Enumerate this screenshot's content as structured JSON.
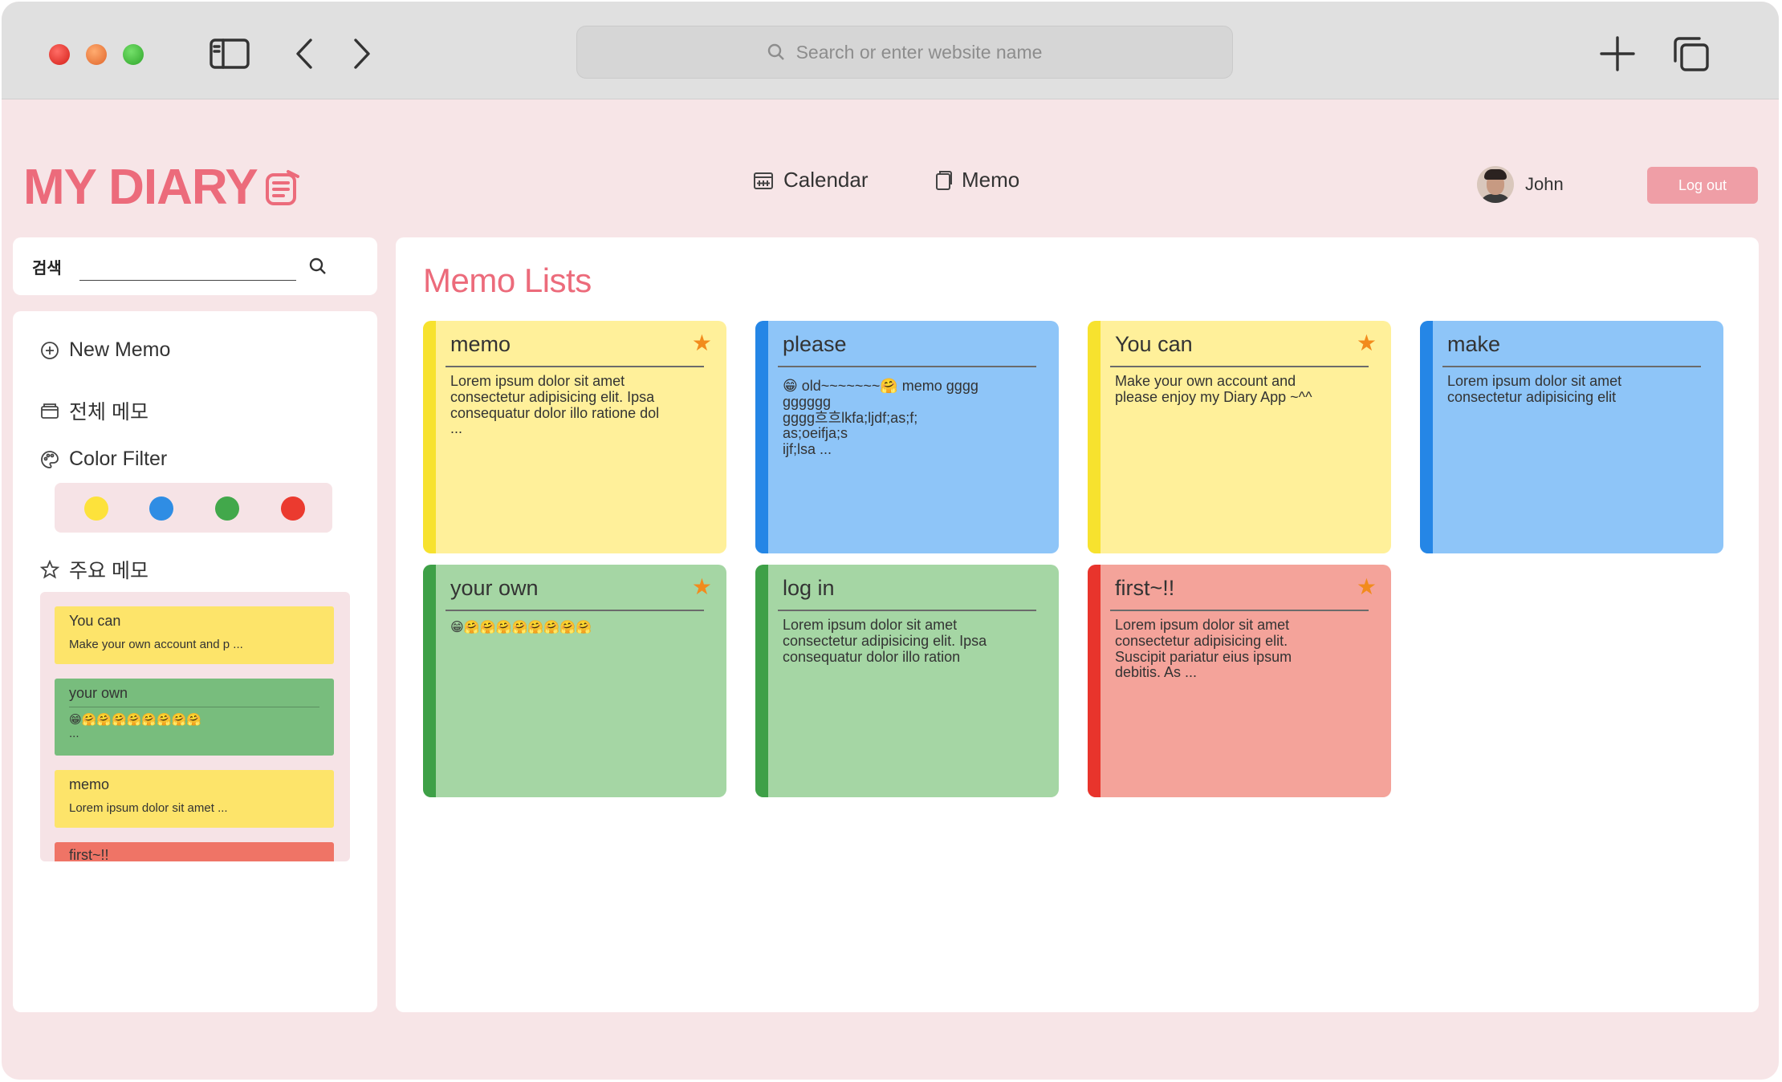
{
  "browser": {
    "address_placeholder": "Search or enter website name"
  },
  "header": {
    "logo": "MY DIARY",
    "nav": {
      "calendar": "Calendar",
      "memo": "Memo"
    },
    "user_name": "John",
    "logout": "Log out"
  },
  "sidebar": {
    "search_label": "검색",
    "search_value": "",
    "new_memo": "New Memo",
    "all_memos": "전체 메모",
    "color_filter": "Color Filter",
    "filter_colors": [
      "#fde23b",
      "#2f8de4",
      "#42a84b",
      "#eb3a2f"
    ],
    "favorites_title": "주요 메모",
    "favorites": [
      {
        "title": "You can",
        "body": "Make your own account and p ...",
        "color": "#fde46a"
      },
      {
        "title": "your own",
        "body": "😁🤗🤗🤗🤗🤗🤗🤗🤗",
        "extra": "...",
        "color": "#78bd7d"
      },
      {
        "title": "memo",
        "body": "Lorem ipsum dolor sit amet ...",
        "color": "#fde46a"
      },
      {
        "title": "first~!!",
        "body": "",
        "color": "#ef7466"
      }
    ]
  },
  "main": {
    "title": "Memo Lists",
    "memos": [
      {
        "title": "memo",
        "body": "Lorem ipsum dolor sit amet\nconsectetur adipisicing elit. Ipsa\nconsequatur dolor illo ratione dol\n...",
        "starred": true,
        "bg": "#fff09a",
        "stripe": "#f7e22e"
      },
      {
        "title": "please",
        "body": "😁 old~~~~~~~🤗 memo gggg\ngggggg\ngggg흐흐lkfa;ljdf;as;f;\nas;oeifja;s\nijf;lsa ...",
        "starred": false,
        "bg": "#8ec5f8",
        "stripe": "#2586e6"
      },
      {
        "title": "You can",
        "body": "Make your own account and\nplease enjoy my Diary App ~^^",
        "starred": true,
        "bg": "#fff09a",
        "stripe": "#f7e22e"
      },
      {
        "title": "make",
        "body": "Lorem ipsum dolor sit amet\nconsectetur adipisicing elit",
        "starred": false,
        "bg": "#8ec5f8",
        "stripe": "#2586e6"
      },
      {
        "title": "your own",
        "body": "😁🤗🤗🤗🤗🤗🤗🤗🤗",
        "starred": true,
        "bg": "#a5d6a4",
        "stripe": "#3ea047"
      },
      {
        "title": "log in",
        "body": "Lorem ipsum dolor sit amet\nconsectetur adipisicing elit. Ipsa\nconsequatur dolor illo ration",
        "starred": false,
        "bg": "#a5d6a4",
        "stripe": "#3ea047"
      },
      {
        "title": "first~!!",
        "body": "Lorem ipsum dolor sit amet\nconsectetur adipisicing elit.\nSuscipit pariatur eius ipsum\ndebitis. As ...",
        "starred": true,
        "bg": "#f4a39a",
        "stripe": "#e8342c"
      }
    ]
  }
}
